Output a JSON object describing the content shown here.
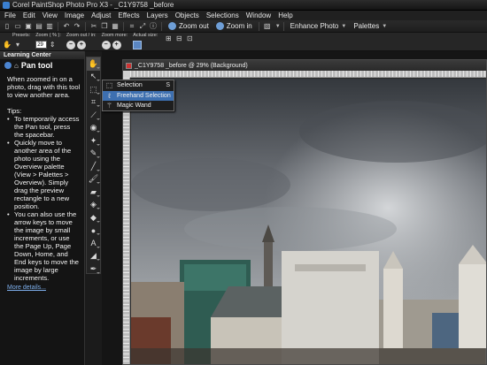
{
  "window": {
    "title": "Corel PaintShop Photo Pro X3 - _C1Y9758 _before"
  },
  "menu": [
    "File",
    "Edit",
    "View",
    "Image",
    "Adjust",
    "Effects",
    "Layers",
    "Objects",
    "Selections",
    "Window",
    "Help"
  ],
  "toolbar": {
    "zoom_out_label": "Zoom out",
    "zoom_in_label": "Zoom in",
    "enhance_photo_label": "Enhance Photo",
    "palettes_label": "Palettes"
  },
  "tool_options": {
    "presets_label": "Presets:",
    "zoom_label": "Zoom ( % ):",
    "zoom_value": "29",
    "zoom_out_in_label": "Zoom out / in:",
    "zoom_more_label": "Zoom more:",
    "actual_size_label": "Actual size:"
  },
  "learning_center": {
    "header": "Learning Center",
    "title": "Pan tool",
    "intro": "When zoomed in on a photo, drag with this tool to view another area.",
    "tips_label": "Tips:",
    "tips": [
      "To temporarily access the Pan tool, press the spacebar.",
      "Quickly move to another area of the photo using the Overview palette (View > Palettes > Overview). Simply drag the preview rectangle to a new position.",
      "You can also use the arrow keys to move the image by small increments, or use the Page Up, Page Down, Home, and End keys to move the image by large increments."
    ],
    "more_details": "More details..."
  },
  "document": {
    "title": "_C1Y9758 _before @  29% (Background)"
  },
  "flyout": {
    "items": [
      {
        "label": "Selection",
        "shortcut": "S"
      },
      {
        "label": "Freehand Selection",
        "shortcut": ""
      },
      {
        "label": "Magic Wand",
        "shortcut": ""
      }
    ]
  },
  "colors": {
    "accent": "#3d6fb0",
    "link": "#7fb1ef"
  }
}
